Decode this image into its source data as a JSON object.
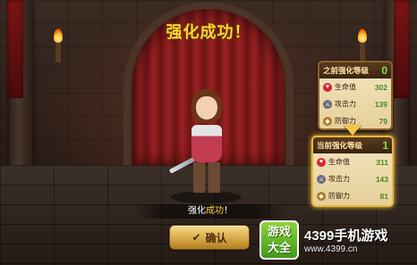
{
  "title": "强化成功！",
  "success_message": {
    "prefix": "强化",
    "highlight": "成功",
    "suffix": "！"
  },
  "confirm_button": {
    "label": "确认",
    "icon": "checkmark-icon"
  },
  "before_panel": {
    "title": "之前强化等级",
    "level": "0",
    "stats": [
      {
        "icon": "heart-icon",
        "label": "生命值",
        "value": "302"
      },
      {
        "icon": "sword-icon",
        "label": "攻击力",
        "value": "139"
      },
      {
        "icon": "shield-icon",
        "label": "防御力",
        "value": "79"
      }
    ]
  },
  "after_panel": {
    "title": "当前强化等级",
    "level": "1",
    "stats": [
      {
        "icon": "heart-icon",
        "label": "生命值",
        "value": "311"
      },
      {
        "icon": "sword-icon",
        "label": "攻击力",
        "value": "143"
      },
      {
        "icon": "shield-icon",
        "label": "防御力",
        "value": "81"
      }
    ]
  },
  "watermark": {
    "badge_line1": "游戏",
    "badge_line2": "大全",
    "name": "4399手机游戏",
    "url": "www.4399.cn"
  },
  "colors": {
    "title_gold": "#ffd23a",
    "level_green": "#7be04a",
    "value_green": "#4a8a20",
    "panel_highlight": "#e8b63a"
  }
}
